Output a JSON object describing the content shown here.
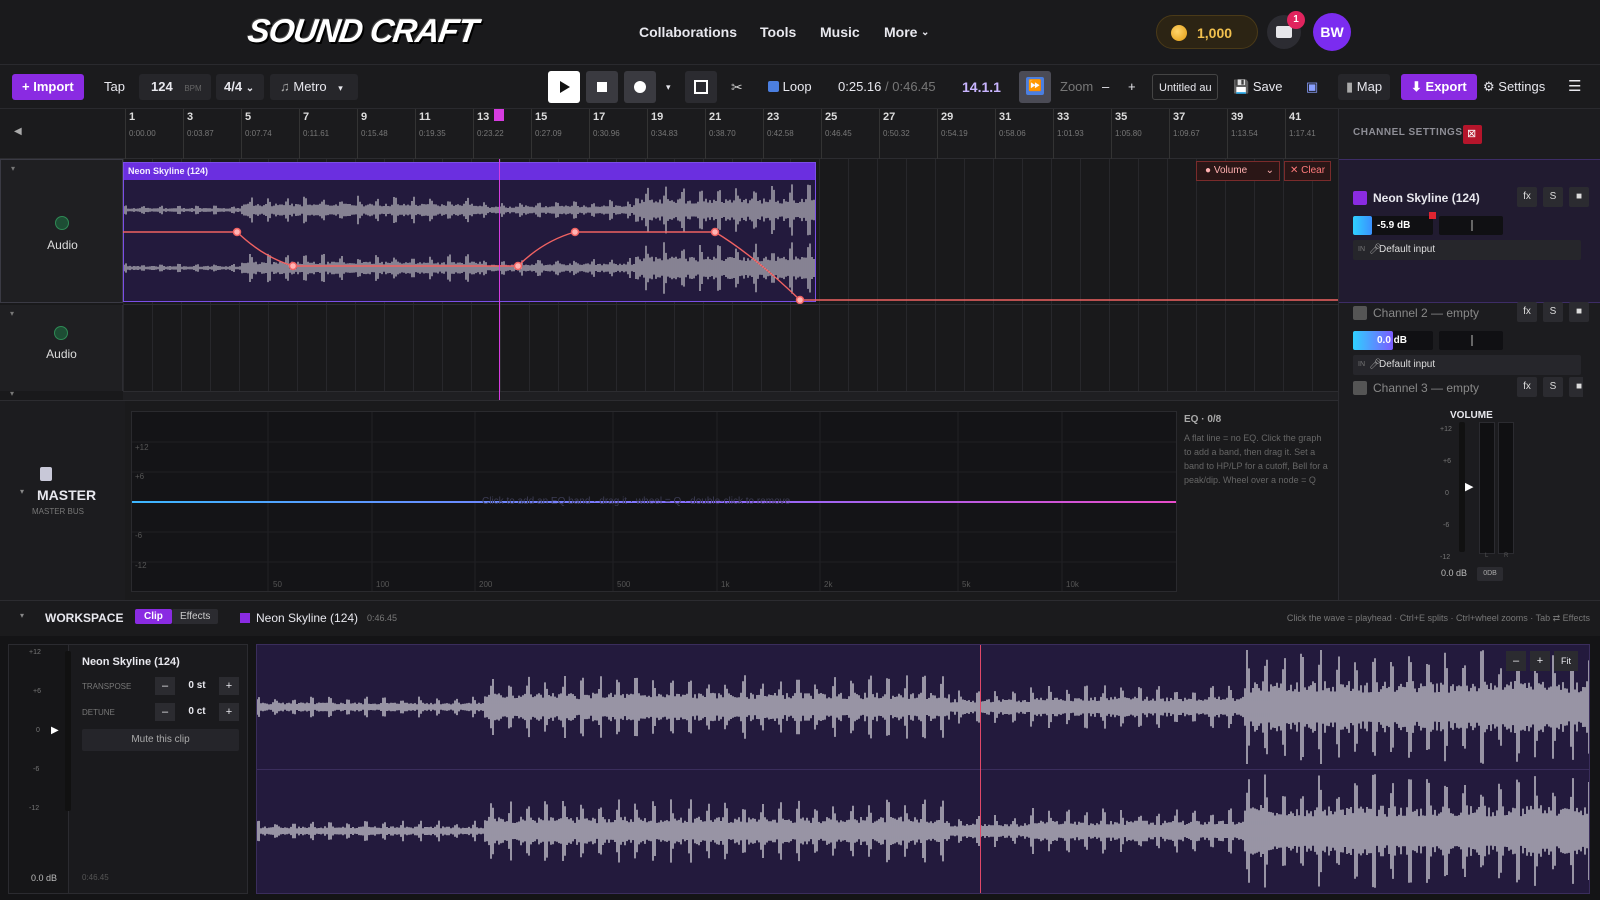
{
  "nav": {
    "logo": "SOUND CRAFT",
    "links": [
      "Collaborations",
      "Tools",
      "Music",
      "More"
    ],
    "coins": "1,000",
    "mail_badge": "1",
    "avatar": "BW"
  },
  "toolbar": {
    "import": "+ Import",
    "tap": "Tap",
    "bpm": "124",
    "bpm_unit": "BPM",
    "time_sig": "4/4",
    "metro": "Metro",
    "loop": "Loop",
    "time_current": "0:25.16",
    "time_sep": "/",
    "time_total": "0:46.45",
    "position": "14.1.1",
    "zoom": "Zoom",
    "zoom_minus": "–",
    "zoom_plus": "+",
    "project_name": "Untitled au",
    "save": "Save",
    "map": "Map",
    "export": "Export",
    "settings": "Settings"
  },
  "ruler": {
    "bars": [
      {
        "n": "1",
        "t": "0:00.00"
      },
      {
        "n": "3",
        "t": "0:03.87"
      },
      {
        "n": "5",
        "t": "0:07.74"
      },
      {
        "n": "7",
        "t": "0:11.61"
      },
      {
        "n": "9",
        "t": "0:15.48"
      },
      {
        "n": "11",
        "t": "0:19.35"
      },
      {
        "n": "13",
        "t": "0:23.22"
      },
      {
        "n": "15",
        "t": "0:27.09"
      },
      {
        "n": "17",
        "t": "0:30.96"
      },
      {
        "n": "19",
        "t": "0:34.83"
      },
      {
        "n": "21",
        "t": "0:38.70"
      },
      {
        "n": "23",
        "t": "0:42.58"
      },
      {
        "n": "25",
        "t": "0:46.45"
      },
      {
        "n": "27",
        "t": "0:50.32"
      },
      {
        "n": "29",
        "t": "0:54.19"
      },
      {
        "n": "31",
        "t": "0:58.06"
      },
      {
        "n": "33",
        "t": "1:01.93"
      },
      {
        "n": "35",
        "t": "1:05.80"
      },
      {
        "n": "37",
        "t": "1:09.67"
      },
      {
        "n": "39",
        "t": "1:13.54"
      },
      {
        "n": "41",
        "t": "1:17.41"
      },
      {
        "n": "4",
        "t": ""
      }
    ]
  },
  "tracks": [
    {
      "name": "Audio"
    },
    {
      "name": "Audio"
    }
  ],
  "clip": {
    "name": "Neon Skyline (124)"
  },
  "automation": {
    "param": "Volume",
    "clear": "Clear"
  },
  "channel_settings": {
    "title": "CHANNEL SETTINGS",
    "channels": [
      {
        "name": "Neon Skyline (124)",
        "db": "-5.9 dB",
        "input": "Default input",
        "color": "#8a2be2"
      },
      {
        "name": "Channel 2 — empty",
        "db": "0.0 dB",
        "input": "Default input",
        "color": "#555"
      },
      {
        "name": "Channel 3 — empty",
        "db": "",
        "input": "",
        "color": "#555"
      }
    ],
    "fx": "fx",
    "solo": "S"
  },
  "master": {
    "title": "MASTER",
    "subtitle": "MASTER BUS",
    "eq_title": "EQ · 0/8",
    "eq_hint": "Click to add an EQ band · drag it · wheel = Q · double-click to remove",
    "eq_db_labels": [
      "+12",
      "+6",
      "-6",
      "-12"
    ],
    "eq_freq_labels": [
      "50",
      "100",
      "200",
      "500",
      "1k",
      "2k",
      "5k",
      "10k"
    ],
    "help_text": "A flat line = no EQ. Click the graph to add a band, then drag it. Set a band to HP/LP for a cutoff, Bell for a peak/dip. Wheel over a node = Q",
    "volume_title": "VOLUME",
    "vol_scale": [
      "+12",
      "+6",
      "0",
      "-6",
      "-12"
    ],
    "vol_db": "0.0 dB",
    "vol_btn": "0DB",
    "meter_l": "L",
    "meter_r": "R"
  },
  "workspace": {
    "title": "WORKSPACE",
    "tab_clip": "Clip",
    "tab_effects": "Effects",
    "clip_name": "Neon Skyline (124)",
    "clip_len": "0:46.45",
    "shortcuts": "Click the wave = playhead · Ctrl+E splits · Ctrl+wheel zooms · Tab ⇄ Effects",
    "transpose_label": "TRANSPOSE",
    "transpose_val": "0 st",
    "detune_label": "DETUNE",
    "detune_val": "0 ct",
    "mute": "Mute this clip",
    "gain_db": "0.0 dB",
    "len_footer": "0:46.45",
    "scale": [
      "+12",
      "+6",
      "0",
      "-6",
      "-12"
    ],
    "zoom_out": "–",
    "zoom_in": "+",
    "fit": "Fit"
  },
  "colors": {
    "accent": "#8a2be2",
    "automation": "#f06262",
    "playhead": "#d63ce0",
    "waveform": "#c8c8cc"
  }
}
